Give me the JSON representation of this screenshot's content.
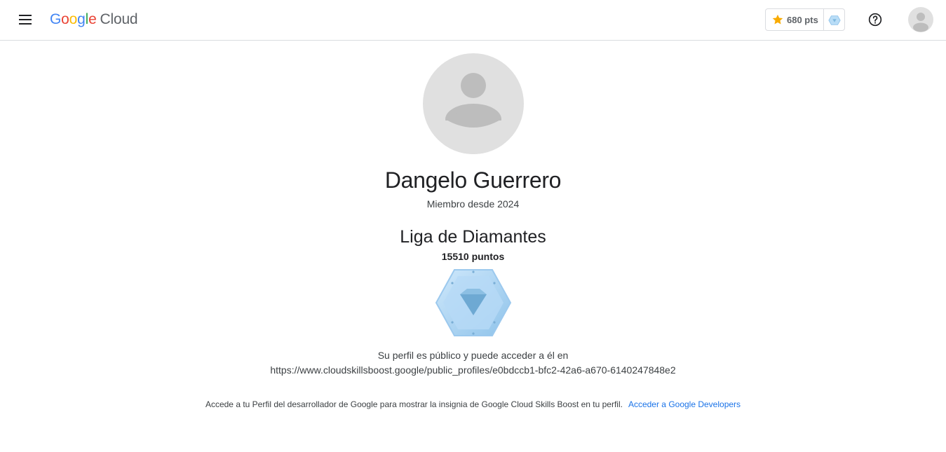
{
  "header": {
    "logo": {
      "google_letters": [
        "G",
        "o",
        "o",
        "g",
        "l",
        "e"
      ],
      "product": "Cloud"
    },
    "points_chip": {
      "label": "680 pts",
      "star_color": "#f9ab00"
    },
    "icons": {
      "menu": "menu-icon",
      "help": "help-circle-icon",
      "avatar": "account-avatar-icon"
    }
  },
  "profile": {
    "name": "Dangelo Guerrero",
    "member_since": "Miembro desde 2024",
    "league": {
      "title": "Liga de Diamantes",
      "points": "15510 puntos",
      "badge_icon": "diamond-league-badge-icon"
    },
    "public_notice": "Su perfil es público y puede acceder a él en",
    "public_url": "https://www.cloudskillsboost.google/public_profiles/e0bdccb1-bfc2-42a6-a670-6140247848e2",
    "developer_notice": "Accede a tu Perfil del desarrollador de Google para mostrar la insignia de Google Cloud Skills Boost en tu perfil.",
    "developer_link": "Acceder a Google Developers"
  },
  "colors": {
    "link": "#1a73e8",
    "divider": "#dadce0",
    "avatar_bg": "#e0e0e0",
    "avatar_fg": "#bdbdbd",
    "diamond": "#a8d4f5"
  }
}
